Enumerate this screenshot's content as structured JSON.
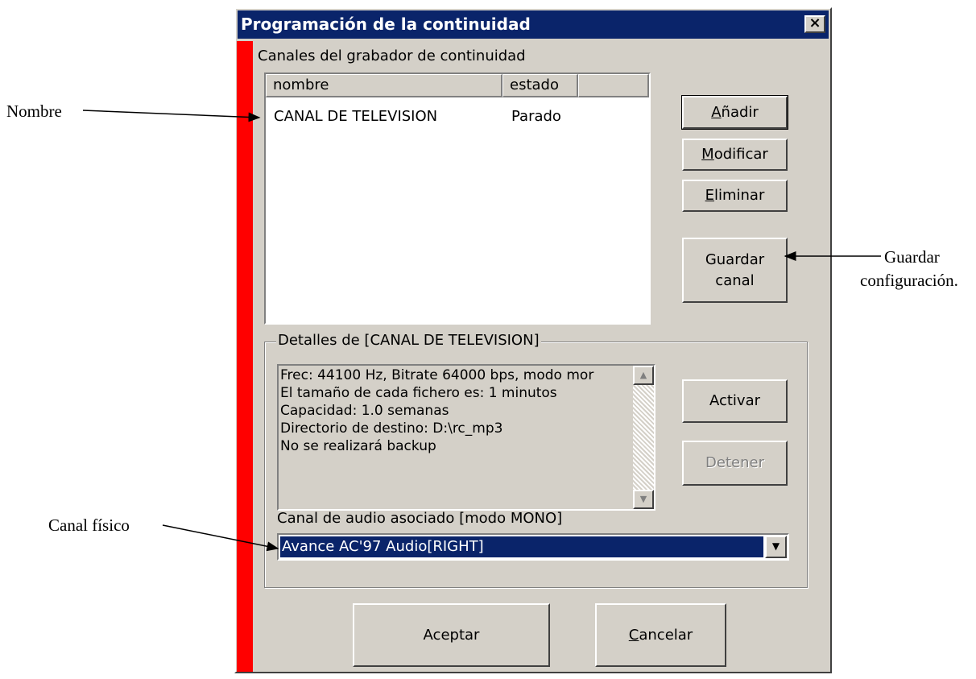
{
  "window": {
    "title": "Programación de la continuidad",
    "close_glyph": "×"
  },
  "channels": {
    "section_label": "Canales del grabador de continuidad",
    "columns": [
      "nombre",
      "estado"
    ],
    "rows": [
      {
        "nombre": "CANAL DE TELEVISION",
        "estado": "Parado"
      }
    ]
  },
  "buttons": {
    "add": {
      "pre": "",
      "key": "A",
      "rest": "ñadir"
    },
    "modify": {
      "pre": "",
      "key": "M",
      "rest": "odificar"
    },
    "delete": {
      "pre": "",
      "key": "E",
      "rest": "liminar"
    },
    "save_channel": "Guardar\ncanal",
    "activate": "Activar",
    "stop": "Detener",
    "accept": "Aceptar",
    "cancel": {
      "pre": "",
      "key": "C",
      "rest": "ancelar"
    }
  },
  "details": {
    "group_label": "Detalles de [CANAL DE TELEVISION]",
    "lines": [
      "Frec: 44100 Hz, Bitrate 64000 bps, modo mor",
      "El tamaño de cada fichero es: 1 minutos",
      "Capacidad: 1.0 semanas",
      "Directorio de destino: D:\\rc_mp3",
      "No se realizará backup"
    ],
    "scroll_up_glyph": "▲",
    "scroll_down_glyph": "▼"
  },
  "audio": {
    "label": "Canal de audio asociado [modo MONO]",
    "selected": "Avance AC'97 Audio[RIGHT]",
    "dropdown_glyph": "▼"
  },
  "annotations": {
    "nombre": "Nombre",
    "guardar_line1": "Guardar",
    "guardar_line2": "configuración.",
    "canal_fisico": "Canal físico"
  },
  "colors": {
    "face": "#d4d0c8",
    "titlebar": "#0a246a",
    "red_bar": "#ff0000",
    "selection": "#0a246a"
  }
}
